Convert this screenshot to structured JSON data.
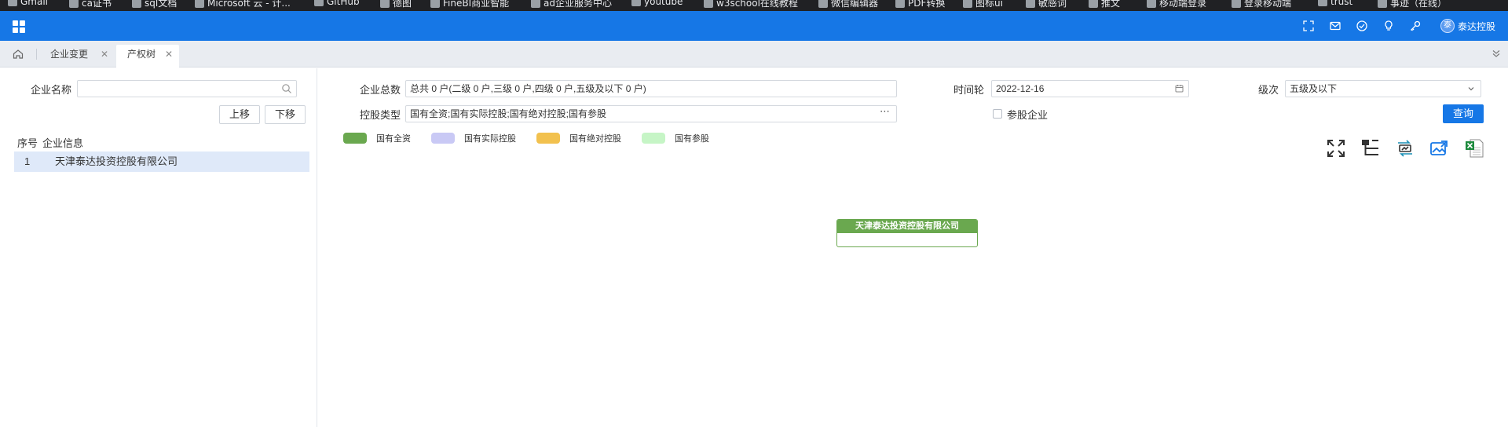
{
  "browser_bookmarks": [
    {
      "label": "Gmail",
      "icon": "gmail-icon"
    },
    {
      "label": "ca证书",
      "icon": "star-icon"
    },
    {
      "label": "sql文档",
      "icon": "windows-icon"
    },
    {
      "label": "Microsoft 云 - 计...",
      "icon": "windows-icon"
    },
    {
      "label": "GitHub",
      "icon": "github-icon"
    },
    {
      "label": "德图",
      "icon": "star-icon"
    },
    {
      "label": "FineBI商业智能",
      "icon": "globe-icon"
    },
    {
      "label": "ad企业服务中心",
      "icon": "app-icon"
    },
    {
      "label": "youtube",
      "icon": "globe-icon"
    },
    {
      "label": "w3school在线教程",
      "icon": "w3-icon"
    },
    {
      "label": "微信编辑器",
      "icon": "app-icon"
    },
    {
      "label": "PDF转换",
      "icon": "pdf-icon"
    },
    {
      "label": "图标ui",
      "icon": "star-icon"
    },
    {
      "label": "敏感词",
      "icon": "globe-icon"
    },
    {
      "label": "推文",
      "icon": "app-icon"
    },
    {
      "label": "移动端登录",
      "icon": "app-icon"
    },
    {
      "label": "登录移动端",
      "icon": "globe-icon"
    },
    {
      "label": "trust",
      "icon": "globe-icon"
    },
    {
      "label": "事迹（在线）",
      "icon": "globe-icon"
    }
  ],
  "header": {
    "menu_icon": "grid-icon",
    "icons": [
      "fullscreen-icon",
      "mail-icon",
      "check-circle-icon",
      "bulb-icon",
      "key-icon"
    ],
    "user": {
      "avatar_text": "泰",
      "name": "泰达控股"
    }
  },
  "tabs": [
    {
      "label": "企业变更",
      "active": false,
      "closable": true
    },
    {
      "label": "产权树",
      "active": true,
      "closable": true
    }
  ],
  "left_panel": {
    "company_name_label": "企业名称",
    "company_name_value": "",
    "move_up_label": "上移",
    "move_down_label": "下移",
    "columns": [
      "序号",
      "企业信息"
    ],
    "rows": [
      {
        "index": "1",
        "name": "天津泰达投资控股有限公司"
      }
    ]
  },
  "form": {
    "total_label": "企业总数",
    "total_value": "总共 0 户(二级 0 户,三级 0 户,四级 0 户,五级及以下 0 户)",
    "time_label": "时间轮",
    "time_value": "2022-12-16",
    "level_label": "级次",
    "level_value": "五级及以下",
    "holding_type_label": "控股类型",
    "holding_type_value": "国有全资;国有实际控股;国有绝对控股;国有参股",
    "participating_label": "参股企业",
    "participating_checked": false,
    "query_label": "查询"
  },
  "legend": [
    {
      "label": "国有全资",
      "color": "#6aa84f"
    },
    {
      "label": "国有实际控股",
      "color": "#c9c9f5"
    },
    {
      "label": "国有绝对控股",
      "color": "#f2c14e"
    },
    {
      "label": "国有参股",
      "color": "#c6f5c6"
    }
  ],
  "toolbar": {
    "icons": [
      "expand-icon",
      "tree-structure-icon",
      "switch-layout-icon",
      "export-image-icon",
      "export-excel-icon"
    ]
  },
  "tree": {
    "root_title": "天津泰达投资控股有限公司",
    "root_color": "#6aa84f"
  }
}
